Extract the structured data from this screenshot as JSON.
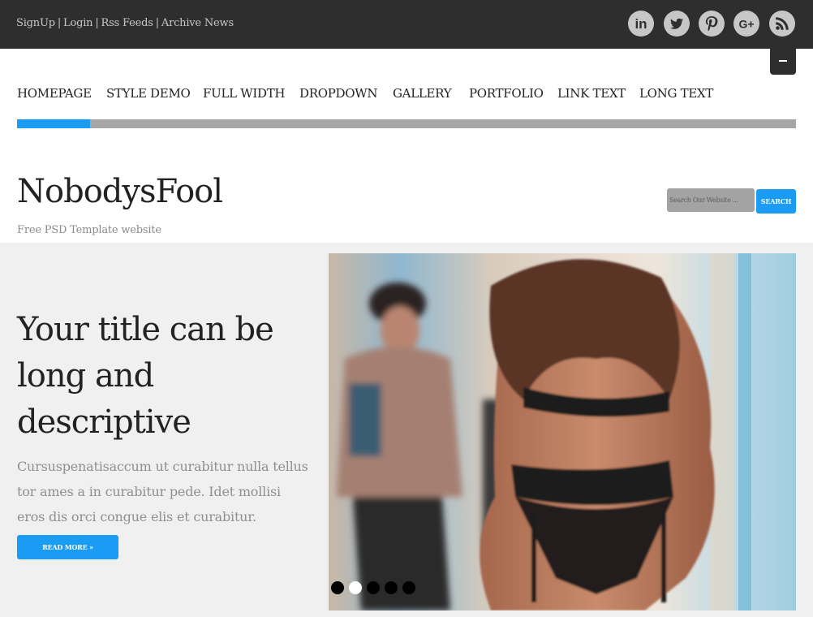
{
  "topbar": {
    "links": [
      "SignUp",
      "Login",
      "Rss Feeds",
      "Archive News"
    ],
    "separator": "|",
    "social": [
      {
        "name": "linkedin",
        "glyph": "in"
      },
      {
        "name": "twitter",
        "glyph": ""
      },
      {
        "name": "pinterest",
        "glyph": ""
      },
      {
        "name": "google-plus",
        "glyph": "G+"
      },
      {
        "name": "rss",
        "glyph": ""
      }
    ],
    "social_color": "#c7c7c7"
  },
  "nav": {
    "items": [
      "HOMEPAGE",
      "STYLE DEMO",
      "FULL WIDTH",
      "DROPDOWN",
      "GALLERY",
      "PORTFOLIO",
      "LINK TEXT",
      "LONG TEXT"
    ],
    "active_index": 0,
    "accent": "#1a9cf5"
  },
  "site": {
    "title": "NobodysFool",
    "tagline": "Free PSD Template website"
  },
  "search": {
    "placeholder": "Search Our Website ...",
    "button_label": "SEARCH"
  },
  "hero": {
    "title": "Your title can be long and descriptive",
    "body": "Cursuspenatisaccum ut curabitur nulla tellus tor ames a in curabitur pede. Idet mollisi eros dis orci congue elis et curabitur.",
    "button_label": "READ MORE »",
    "slides_count": 5,
    "active_slide": 1
  }
}
